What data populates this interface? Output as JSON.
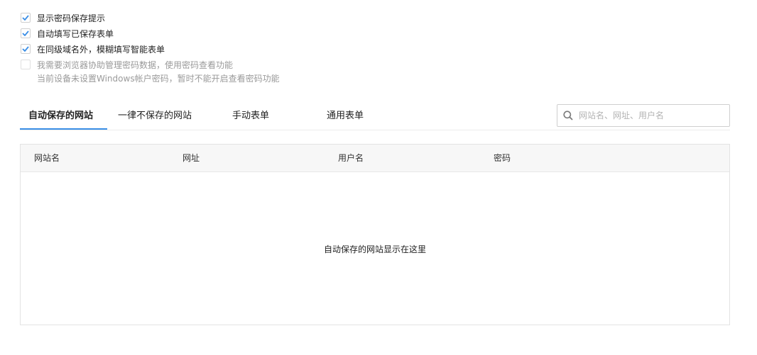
{
  "options": [
    {
      "label": "显示密码保存提示",
      "checked": true,
      "disabled": false
    },
    {
      "label": "自动填写已保存表单",
      "checked": true,
      "disabled": false
    },
    {
      "label": "在同级域名外，模糊填写智能表单",
      "checked": true,
      "disabled": false
    },
    {
      "label": "我需要浏览器协助管理密码数据，使用密码查看功能",
      "checked": false,
      "disabled": true
    }
  ],
  "hint": "当前设备未设置Windows帐户密码，暂时不能开启查看密码功能",
  "tabs": [
    {
      "label": "自动保存的网站",
      "active": true
    },
    {
      "label": "一律不保存的网站",
      "active": false
    },
    {
      "label": "手动表单",
      "active": false
    },
    {
      "label": "通用表单",
      "active": false
    }
  ],
  "search": {
    "placeholder": "网站名、网址、用户名",
    "value": ""
  },
  "table": {
    "columns": [
      "网站名",
      "网址",
      "用户名",
      "密码"
    ],
    "empty_text": "自动保存的网站显示在这里"
  },
  "colors": {
    "accent": "#3a8ee6"
  },
  "icons": {
    "check": "checkmark-icon",
    "search": "search-icon"
  }
}
